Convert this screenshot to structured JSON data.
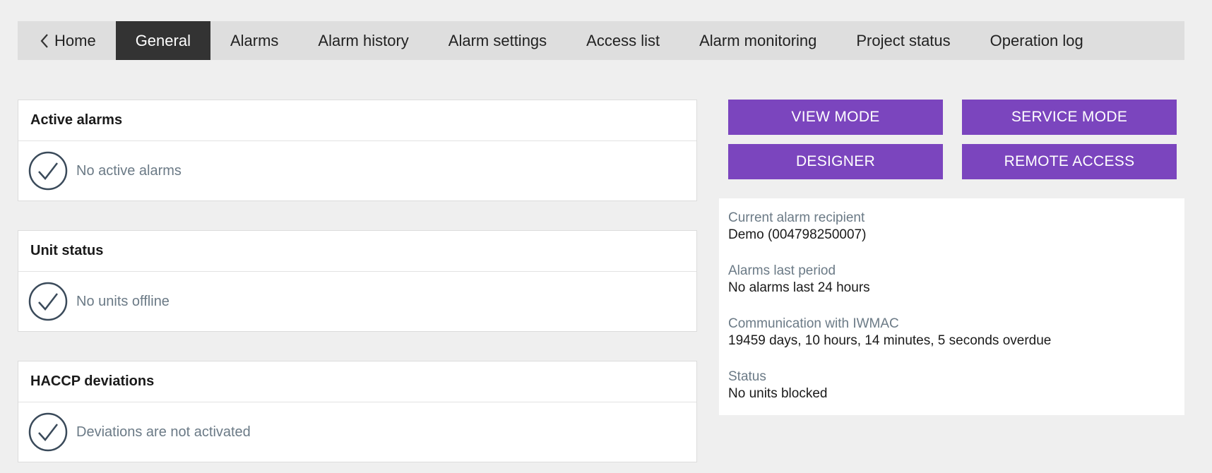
{
  "nav": {
    "home": "Home",
    "tabs": [
      {
        "label": "General",
        "active": true
      },
      {
        "label": "Alarms"
      },
      {
        "label": "Alarm history"
      },
      {
        "label": "Alarm settings"
      },
      {
        "label": "Access list"
      },
      {
        "label": "Alarm monitoring"
      },
      {
        "label": "Project status"
      },
      {
        "label": "Operation log"
      }
    ]
  },
  "cards": {
    "active_alarms": {
      "title": "Active alarms",
      "text": "No active alarms",
      "icon": "check-circle-icon"
    },
    "unit_status": {
      "title": "Unit status",
      "text": "No units offline",
      "icon": "check-circle-icon"
    },
    "haccp": {
      "title": "HACCP deviations",
      "text": "Deviations are not activated",
      "icon": "check-circle-icon"
    }
  },
  "buttons": {
    "view_mode": "VIEW MODE",
    "service_mode": "SERVICE MODE",
    "designer": "DESIGNER",
    "remote_access": "REMOTE ACCESS",
    "color": "#7b45be"
  },
  "info": {
    "recipient_label": "Current alarm recipient",
    "recipient_value": "Demo (004798250007)",
    "alarms_label": "Alarms last period",
    "alarms_value": "No alarms last 24 hours",
    "comm_label": "Communication with IWMAC",
    "comm_value": "19459 days, 10 hours, 14 minutes, 5 seconds overdue",
    "status_label": "Status",
    "status_value": "No units blocked"
  }
}
